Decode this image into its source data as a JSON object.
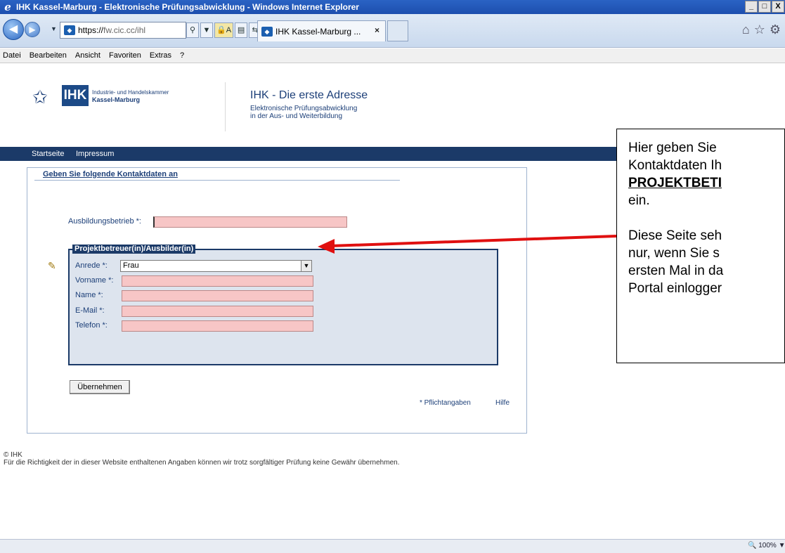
{
  "window": {
    "title": "IHK Kassel-Marburg - Elektronische Prüfungsabwicklung - Windows Internet Explorer",
    "controls": [
      "_",
      "□",
      "X"
    ]
  },
  "address": {
    "scheme": "https://",
    "host": "fw.cic.cc/ihl",
    "search_icon": "search-icon",
    "lock_label": "A"
  },
  "tab": {
    "label": "IHK Kassel-Marburg ...",
    "close": "×"
  },
  "menu": [
    "Datei",
    "Bearbeiten",
    "Ansicht",
    "Favoriten",
    "Extras",
    "?"
  ],
  "header": {
    "logo_ihk": "IHK",
    "logo_line1": "Industrie- und Handelskammer",
    "logo_line2": "Kassel-Marburg",
    "title": "IHK - Die erste Adresse",
    "subtitle1": "Elektronische Prüfungsabwicklung",
    "subtitle2": "in der Aus- und Weiterbildung"
  },
  "nav": {
    "home": "Startseite",
    "imprint": "Impressum"
  },
  "form": {
    "heading": "Geben Sie folgende Kontaktdaten an",
    "company_label": "Ausbildungsbetrieb *:",
    "company_value": "",
    "group_legend": "Projektbetreuer(in)/Ausbilder(in)",
    "salutation_label": "Anrede *:",
    "salutation_value": "Frau",
    "firstname_label": "Vorname *:",
    "lastname_label": "Name *:",
    "email_label": "E-Mail *:",
    "phone_label": "Telefon *:",
    "submit_label": "Übernehmen",
    "required_note": "* Pflichtangaben",
    "help_label": "Hilfe"
  },
  "footer": {
    "copyright": "© IHK",
    "disclaimer": "Für die Richtigkeit der in dieser Website enthaltenen Angaben können wir trotz sorgfältiger Prüfung keine Gewähr übernehmen."
  },
  "callout": {
    "line1": "Hier geben Sie",
    "line2": "Kontaktdaten Ih",
    "line3": "PROJEKTBETI",
    "line4": "ein.",
    "line5": "Diese Seite seh",
    "line6": "nur, wenn Sie s",
    "line7": "ersten Mal in da",
    "line8": "Portal einlogger"
  },
  "status": {
    "zoom": "100%"
  },
  "colors": {
    "nav_blue": "#1b3a68",
    "required_pink": "#f7c6c6",
    "arrow_red": "#e01010"
  }
}
